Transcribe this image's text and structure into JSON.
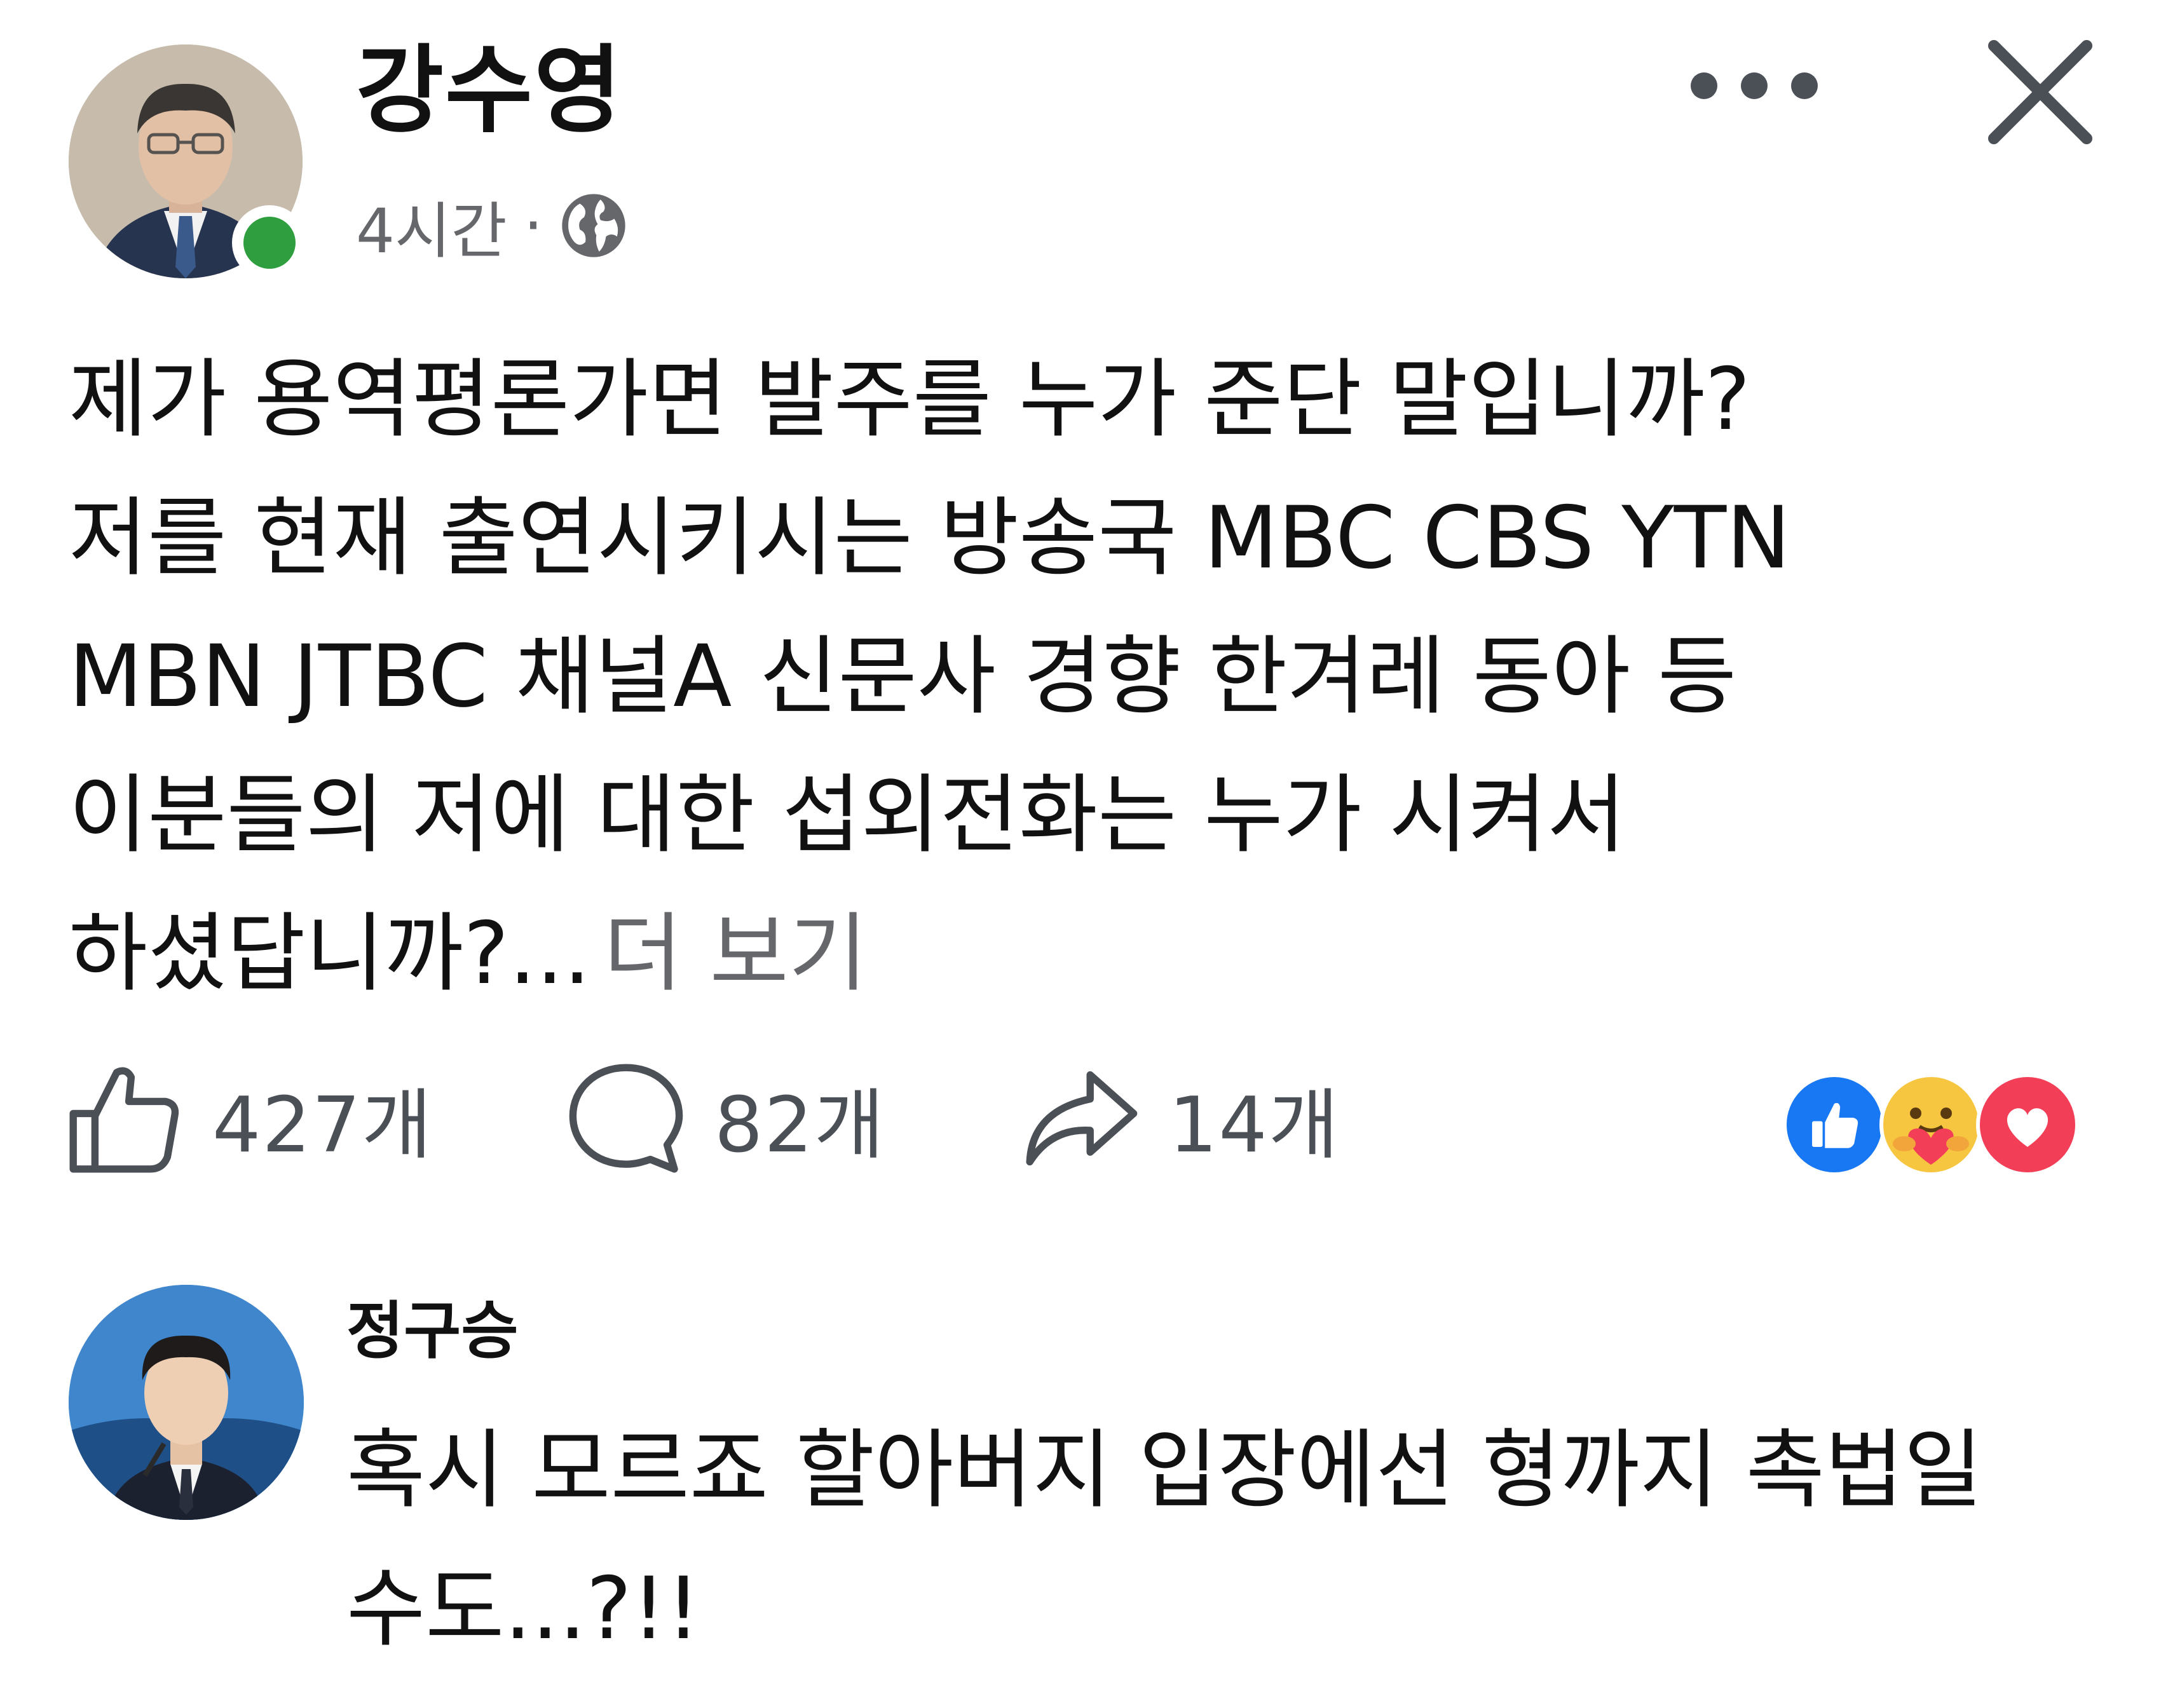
{
  "post": {
    "author_name": "강수영",
    "time": "4시간",
    "separator": "·",
    "body_lines": [
      "제가 용역평론가면 발주를 누가 준단 말입니까?",
      "저를 현재 출연시키시는 방송국 MBC CBS YTN",
      "MBN JTBC 채널A 신문사 경향 한겨레 동아 등",
      "이분들의 저에 대한 섭외전화는 누가 시켜서"
    ],
    "body_last_line": "하셨답니까?...",
    "see_more": "더 보기"
  },
  "actions": {
    "like_count": "427개",
    "comment_count": "82개",
    "share_count": "14개"
  },
  "reactions": [
    "like",
    "care",
    "love"
  ],
  "comment": {
    "author_name": "정구승",
    "text_lines": [
      "혹시 모르죠 할아버지 입장에선 형까지 촉법일",
      "수도...?!!"
    ]
  },
  "colors": {
    "online": "#2e9e3e",
    "muted_text": "#65676b",
    "like_blue": "#1877f2",
    "love_red": "#f33e58",
    "care_yellow": "#f7c641"
  }
}
